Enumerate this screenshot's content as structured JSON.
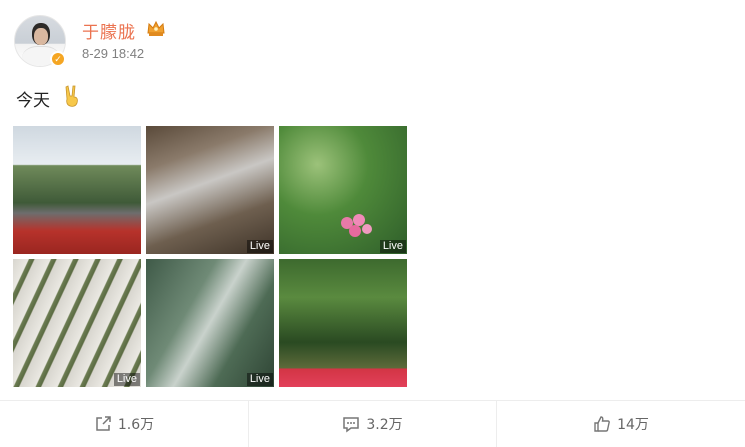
{
  "user": {
    "name": "于朦胧",
    "timestamp": "8-29 18:42"
  },
  "post": {
    "text": "今天"
  },
  "photos": [
    {
      "live": ""
    },
    {
      "live": "Live"
    },
    {
      "live": "Live"
    },
    {
      "live": "Live"
    },
    {
      "live": "Live"
    },
    {
      "live": ""
    }
  ],
  "actions": {
    "share": "1.6万",
    "comment": "3.2万",
    "like": "14万"
  },
  "colors": {
    "username": "#eb7350",
    "verified_badge": "#f5a623"
  },
  "icons": {
    "crown": "crown-badge-icon",
    "hand": "victory-hand-emoji",
    "share": "share-icon",
    "comment": "comment-icon",
    "like": "thumbs-up-icon"
  }
}
